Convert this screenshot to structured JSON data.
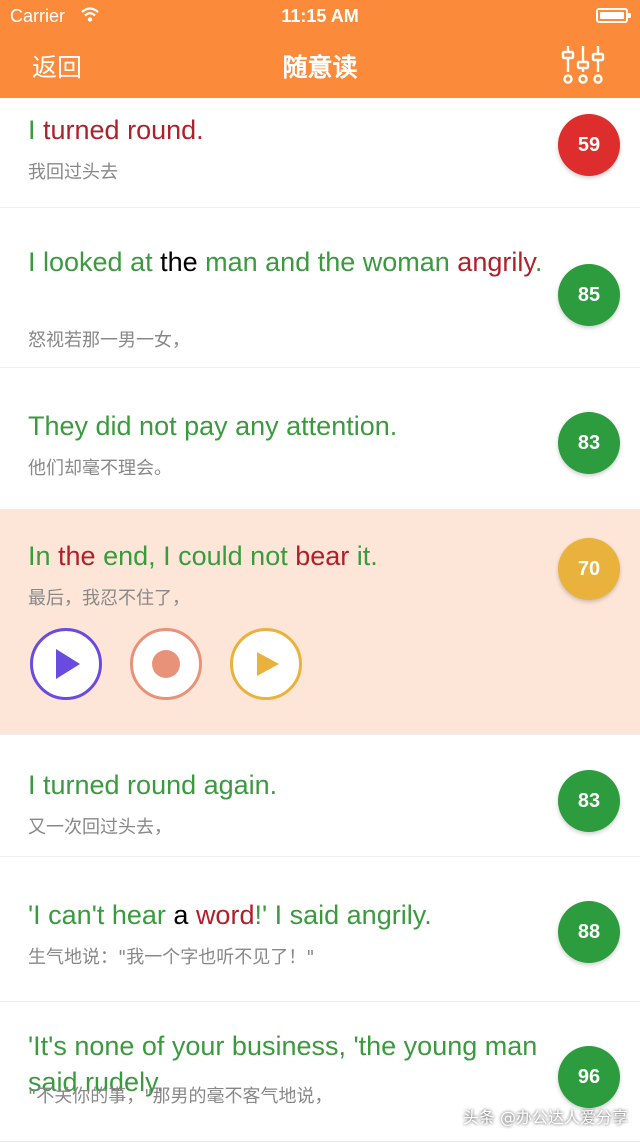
{
  "status_bar": {
    "carrier": "Carrier",
    "time": "11:15 AM"
  },
  "nav": {
    "back_label": "返回",
    "title": "随意读"
  },
  "colors": {
    "accent": "#fb8b3a",
    "correct": "#3a9a3e",
    "wrong": "#b0202a",
    "score_red": "#de2d2d",
    "score_green": "#2c9c3f",
    "score_yellow": "#e8b23c",
    "play": "#6a4be0",
    "record": "#e8927a",
    "playback": "#e8b23c"
  },
  "sentences": [
    {
      "score": "59",
      "translation": "我回过头去",
      "tokens": [
        {
          "t": "I ",
          "c": "g"
        },
        {
          "t": "turned round",
          "c": "r"
        },
        {
          "t": ".",
          "c": "r"
        }
      ]
    },
    {
      "score": "85",
      "translation": "怒视若那一男一女，",
      "tokens": [
        {
          "t": "I looked at ",
          "c": "g"
        },
        {
          "t": "the",
          "c": "k"
        },
        {
          "t": " man and the woman ",
          "c": "g"
        },
        {
          "t": "angrily",
          "c": "r"
        },
        {
          "t": ".",
          "c": "g"
        }
      ]
    },
    {
      "score": "83",
      "translation": "他们却毫不理会。",
      "tokens": [
        {
          "t": "They did not pay any attention.",
          "c": "g"
        }
      ]
    },
    {
      "score": "70",
      "translation": "最后，我忍不住了，",
      "active": true,
      "tokens": [
        {
          "t": "In ",
          "c": "g"
        },
        {
          "t": "the",
          "c": "r"
        },
        {
          "t": " end, I could not ",
          "c": "g"
        },
        {
          "t": "bear",
          "c": "r"
        },
        {
          "t": " it.",
          "c": "g"
        }
      ]
    },
    {
      "score": "83",
      "translation": "又一次回过头去，",
      "tokens": [
        {
          "t": "I turned round again.",
          "c": "g"
        }
      ]
    },
    {
      "score": "88",
      "translation": "生气地说：\"我一个字也听不见了！\"",
      "tokens": [
        {
          "t": "'I can't hear ",
          "c": "g"
        },
        {
          "t": "a",
          "c": "k"
        },
        {
          "t": " ",
          "c": "g"
        },
        {
          "t": "word",
          "c": "r"
        },
        {
          "t": "!' I said angrily.",
          "c": "g"
        }
      ]
    },
    {
      "score": "96",
      "translation": "\"不关你的事，\"那男的毫不客气地说，",
      "tokens": [
        {
          "t": "'It's none of your business, 'the young man said rudely.",
          "c": "g"
        }
      ]
    }
  ],
  "controls": {
    "play_icon": "play-icon",
    "record_icon": "record-icon",
    "playback_icon": "playback-icon"
  },
  "watermark": "头条 @办公达人爱分享"
}
